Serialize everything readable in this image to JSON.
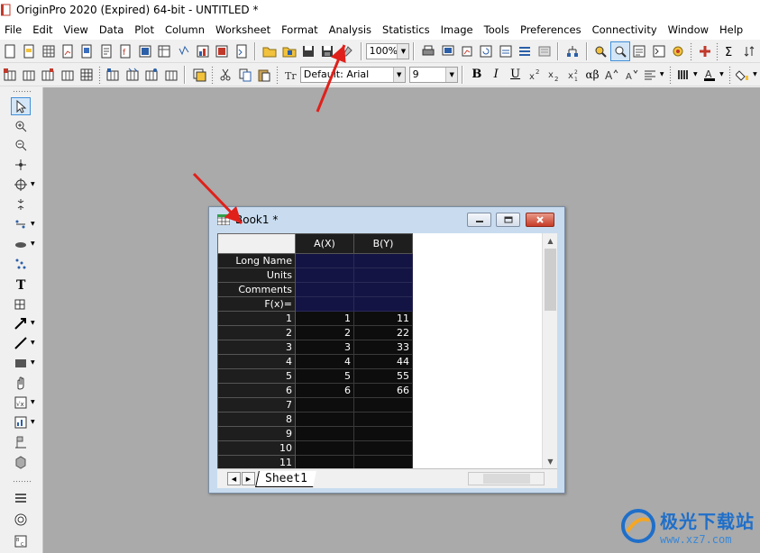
{
  "window": {
    "title": "OriginPro 2020 (Expired) 64-bit - UNTITLED *"
  },
  "menu": [
    "File",
    "Edit",
    "View",
    "Data",
    "Plot",
    "Column",
    "Worksheet",
    "Format",
    "Analysis",
    "Statistics",
    "Image",
    "Tools",
    "Preferences",
    "Connectivity",
    "Window",
    "Help"
  ],
  "toolbar": {
    "zoom": "100%",
    "font_name": "Default: Arial",
    "font_size": "9"
  },
  "format_buttons": {
    "bold": "B",
    "italic": "I",
    "underline": "U",
    "greek": "αβ"
  },
  "book": {
    "title": "Book1 *",
    "sheet_tab": "Sheet1",
    "columns": [
      "A(X)",
      "B(Y)"
    ],
    "meta_rows": [
      "Long Name",
      "Units",
      "Comments",
      "F(x)="
    ],
    "row_numbers": [
      "1",
      "2",
      "3",
      "4",
      "5",
      "6",
      "7",
      "8",
      "9",
      "10",
      "11"
    ],
    "data": [
      [
        "1",
        "11"
      ],
      [
        "2",
        "22"
      ],
      [
        "3",
        "33"
      ],
      [
        "4",
        "44"
      ],
      [
        "5",
        "55"
      ],
      [
        "6",
        "66"
      ],
      [
        "",
        ""
      ],
      [
        "",
        ""
      ],
      [
        "",
        ""
      ],
      [
        "",
        ""
      ],
      [
        "",
        ""
      ]
    ]
  },
  "watermark": {
    "cn": "极光下载站",
    "url": "www.xz7.com"
  },
  "colors": {
    "accent_arrow": "#e0201a",
    "workspace": "#aaaaaa",
    "grid_bg": "#0d0d0d",
    "meta_bg": "#141444"
  }
}
